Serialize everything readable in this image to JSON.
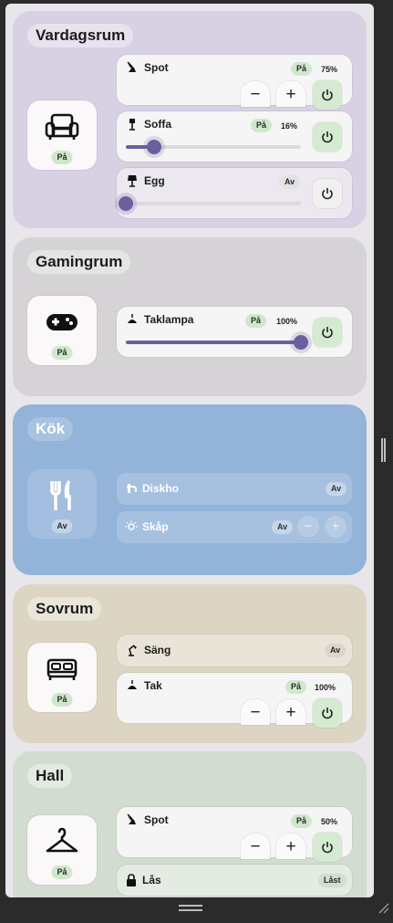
{
  "rooms": {
    "vardagsrum": {
      "title": "Vardagsrum",
      "status": "På",
      "icon": "sofa-icon",
      "color": "#d8d0e3",
      "devices": {
        "spot": {
          "name": "Spot",
          "status": "På",
          "percent": "75%",
          "minus": "−",
          "plus": "+"
        },
        "soffa": {
          "name": "Soffa",
          "status": "På",
          "percent": "16%",
          "level": 0.16
        },
        "egg": {
          "name": "Egg",
          "status": "Av",
          "level": 0.0
        }
      }
    },
    "gamingrum": {
      "title": "Gamingrum",
      "status": "På",
      "icon": "gamepad-icon",
      "color": "#d5d3d6",
      "devices": {
        "taklampa": {
          "name": "Taklampa",
          "status": "På",
          "percent": "100%",
          "level": 1.0
        }
      }
    },
    "kok": {
      "title": "Kök",
      "status": "Av",
      "icon": "fork-knife-icon",
      "color": "#93b3d9",
      "devices": {
        "diskho": {
          "name": "Diskho",
          "status": "Av"
        },
        "skap": {
          "name": "Skåp",
          "status": "Av",
          "minus": "−",
          "plus": "+"
        }
      }
    },
    "sovrum": {
      "title": "Sovrum",
      "status": "På",
      "icon": "bed-icon",
      "color": "#ddd5c3",
      "devices": {
        "sang": {
          "name": "Säng",
          "status": "Av"
        },
        "tak": {
          "name": "Tak",
          "status": "På",
          "percent": "100%",
          "minus": "−",
          "plus": "+"
        }
      }
    },
    "hall": {
      "title": "Hall",
      "status": "På",
      "icon": "hanger-icon",
      "color": "#d3dcd0",
      "devices": {
        "spot": {
          "name": "Spot",
          "status": "På",
          "percent": "50%",
          "minus": "−",
          "plus": "+"
        },
        "las": {
          "name": "Lås",
          "status": "Låst"
        }
      }
    }
  },
  "accent_color": "#6c5f9d",
  "on_color": "#cfe8cc"
}
